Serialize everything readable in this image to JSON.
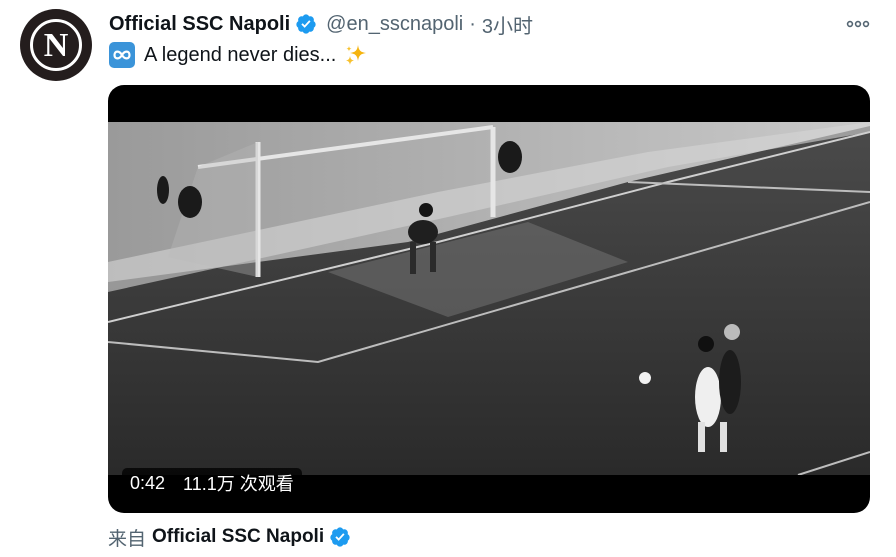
{
  "account": {
    "display_name": "Official SSC Napoli",
    "handle": "@en_sscnapoli",
    "separator": "·",
    "time": "3小时",
    "avatar_letter": "N",
    "verified_color": "#1d9bf0"
  },
  "icons": {
    "more": "more-options-icon",
    "verified": "verified-badge-icon",
    "infinity": "infinity-emoji-icon",
    "sparkles": "sparkles-emoji-icon"
  },
  "tweet": {
    "text": "A legend never dies..."
  },
  "video": {
    "duration": "0:42",
    "views": "11.1万 次观看"
  },
  "source": {
    "prefix": "来自",
    "name": "Official SSC Napoli"
  }
}
